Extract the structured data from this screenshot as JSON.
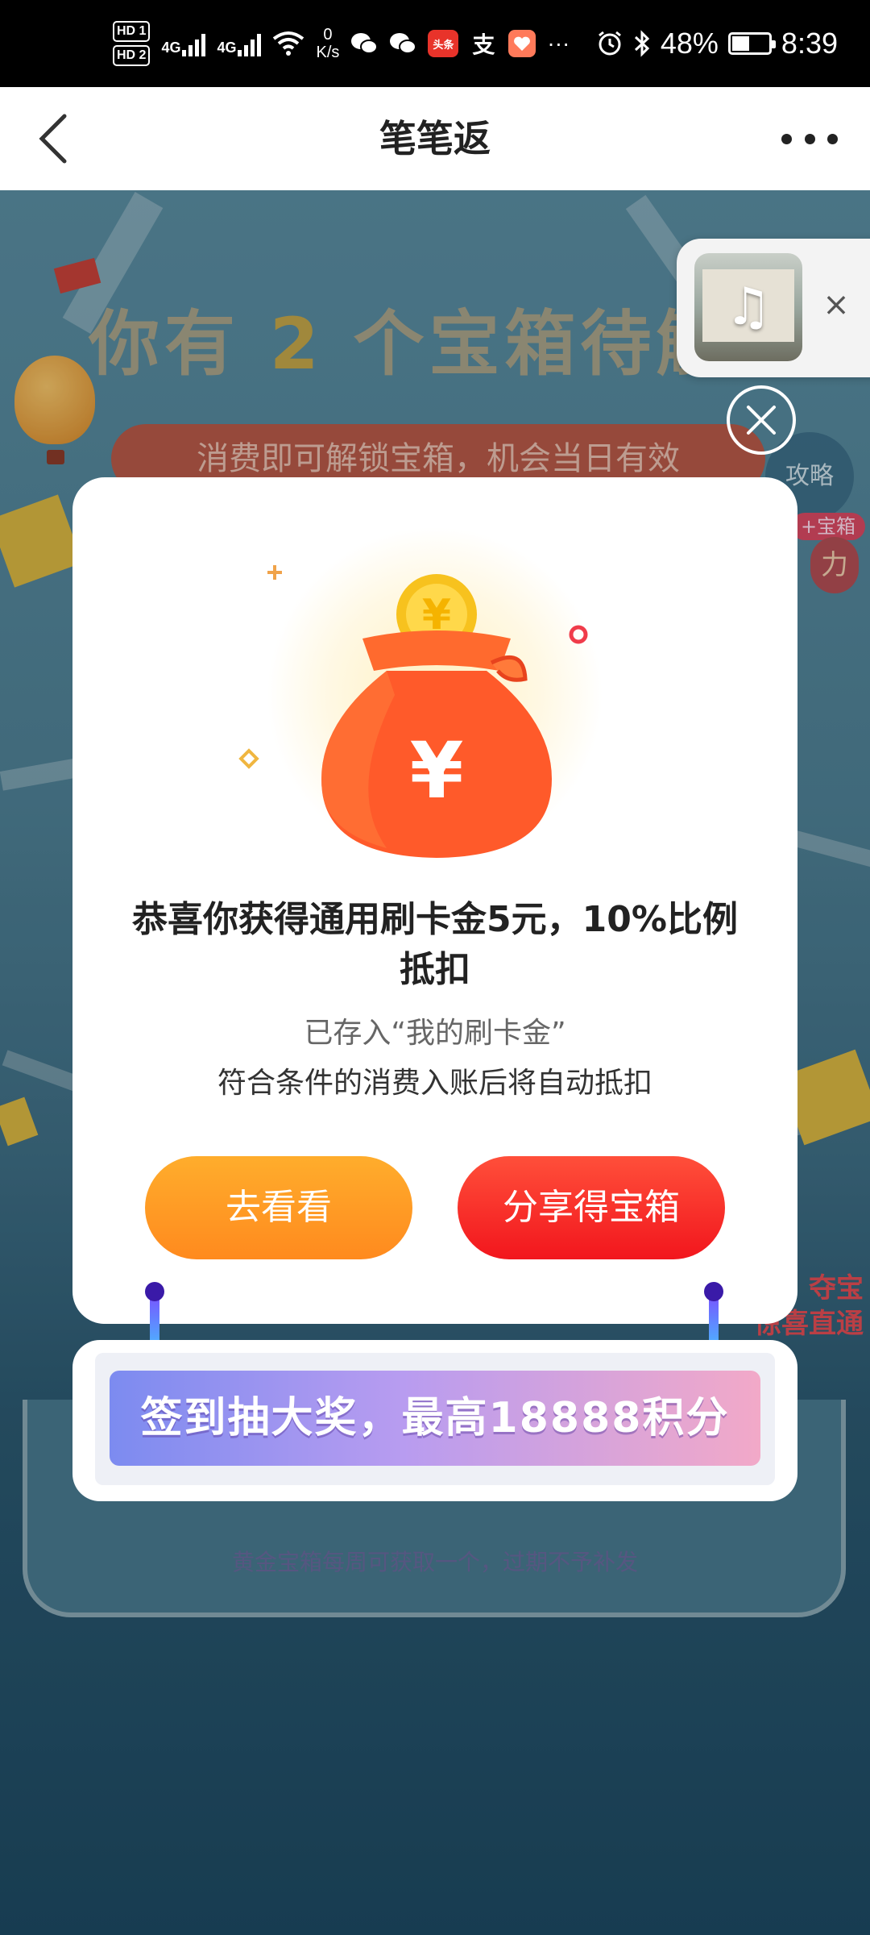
{
  "status_bar": {
    "hd1": "HD 1",
    "hd2": "HD 2",
    "net1": "4G",
    "net2": "4G",
    "speed_value": "0",
    "speed_unit": "K/s",
    "app_toutiao": "头条",
    "app_alipay": "支",
    "more": "···",
    "battery": "48%",
    "battery_level": 0.48,
    "time": "8:39"
  },
  "nav": {
    "title": "笔笔返"
  },
  "background": {
    "headline_pre": "你有",
    "headline_num": "2",
    "headline_post": "个宝箱待解",
    "pill": "消费即可解锁宝箱，机会当日有效",
    "strategy": "攻略",
    "side_badge": "+宝箱",
    "side_bubble": "力",
    "promo_tag_1": "夺宝",
    "promo_tag_2": "惊喜直通",
    "note": "黄金宝箱每周可获取一个，过期不予补发"
  },
  "modal": {
    "title": "恭喜你获得通用刷卡金5元，10%比例抵扣",
    "sub1": "已存入“我的刷卡金”",
    "sub2": "符合条件的消费入账后将自动抵扣",
    "btn_go": "去看看",
    "btn_share": "分享得宝箱",
    "bag_symbol": "¥"
  },
  "banner": {
    "text": "签到抽大奖，最高18888积分"
  },
  "colors": {
    "btn_go": "#ff9a24",
    "btn_share": "#f2161d",
    "bag": "#ff5a2a",
    "coin": "#f7c21e"
  }
}
